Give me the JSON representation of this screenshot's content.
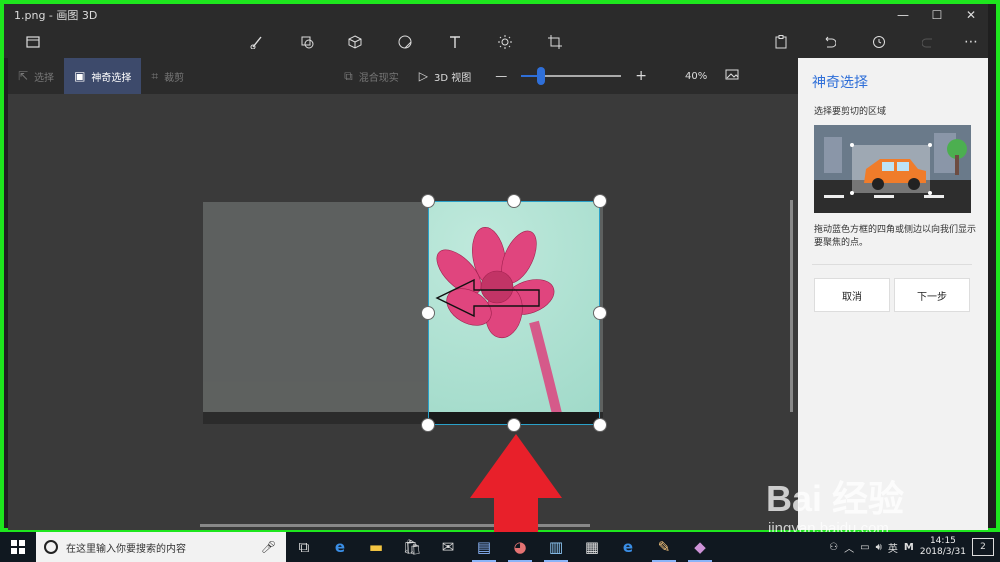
{
  "window": {
    "title": "1.png - 画图 3D",
    "minimize_glyph": "—",
    "maximize_glyph": "☐",
    "close_glyph": "✕"
  },
  "toolbar": {
    "icons": [
      "menu-icon",
      "brush-icon",
      "2d-shapes-icon",
      "3d-shapes-icon",
      "stickers-icon",
      "text-icon",
      "effects-icon",
      "canvas-icon",
      "paste-icon",
      "undo-icon",
      "history-icon",
      "redo-icon",
      "more-icon"
    ],
    "more_glyph": "⋯"
  },
  "commands": {
    "select_label": "选择",
    "magic_select_label": "神奇选择",
    "crop_label": "裁剪",
    "mixed_reality_label": "混合现实",
    "view3d_label": "3D 视图",
    "zoom_minus": "—",
    "zoom_plus": "+",
    "zoom_level": "40%"
  },
  "panel": {
    "title": "神奇选择",
    "subtitle": "选择要剪切的区域",
    "description": "拖动蓝色方框的四角或侧边以向我们显示要聚焦的点。",
    "cancel_label": "取消",
    "next_label": "下一步"
  },
  "watermark": {
    "brand": "Bai 经验",
    "url": "jingyan.baidu.com"
  },
  "taskbar": {
    "search_placeholder": "在这里输入你要搜索的内容",
    "apps": [
      "task-view-icon",
      "edge-icon",
      "file-explorer-icon",
      "store-icon",
      "mail-icon",
      "network-app-icon",
      "paint-app-icon",
      "notepad-app-icon",
      "calculator-icon",
      "edge-browser-icon",
      "paint-brush-icon",
      "paint3d-icon"
    ],
    "ime_label": "英",
    "ime_mode": "M",
    "time": "14:15",
    "date": "2018/3/31",
    "notification_count": "2"
  },
  "colors": {
    "frame": "#1ee61e",
    "accent": "#2f6fd8",
    "arrow": "#e8202a",
    "selection_border": "#2aa0c8"
  }
}
